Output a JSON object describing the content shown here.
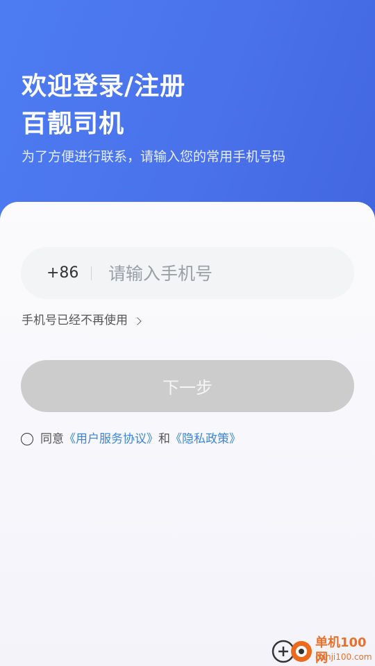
{
  "header": {
    "title_line1": "欢迎登录/注册",
    "title_line2": "百靓司机",
    "subtitle": "为了方便进行联系，请输入您的常用手机号码"
  },
  "login": {
    "country_code": "+86",
    "phone_placeholder": "请输入手机号",
    "phone_value": "",
    "phone_unavailable_link": "手机号已经不再使用",
    "next_button": "下一步"
  },
  "agreement": {
    "prefix": "同意",
    "user_agreement": "《用户服务协议》",
    "conjunction": "和",
    "privacy_policy": "《隐私政策》",
    "checked": false
  },
  "watermark": {
    "name": "单机100网",
    "url": "danji100.com"
  },
  "colors": {
    "header_gradient_start": "#4d7cf2",
    "header_gradient_end": "#4266e0",
    "button_disabled": "#cccccc",
    "link": "#3a86d8",
    "watermark": "#e8712a"
  },
  "icons": {
    "chevron": "chevron-right-icon",
    "radio": "radio-unchecked-icon"
  }
}
